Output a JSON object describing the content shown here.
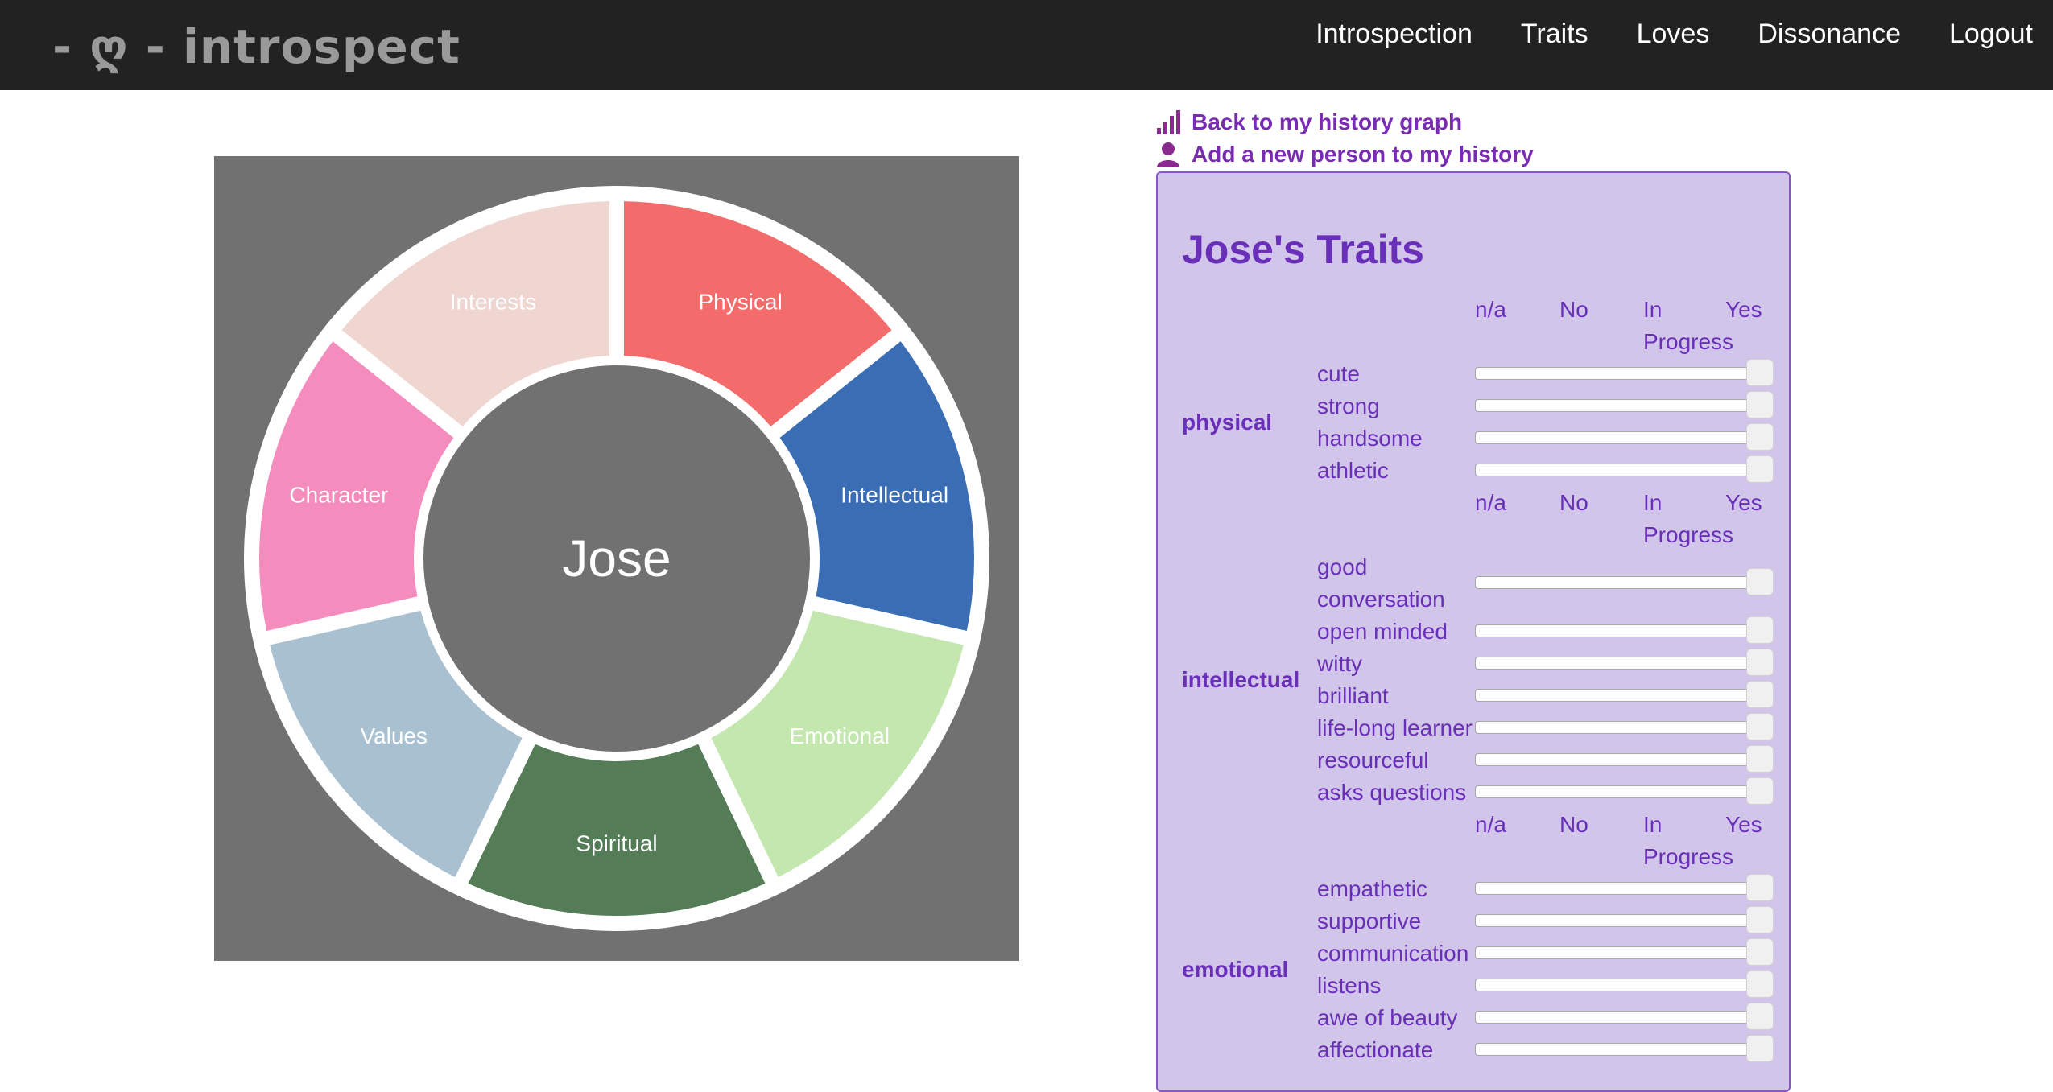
{
  "app": {
    "logo_text": "- ღ - introspect"
  },
  "nav": [
    "Introspection",
    "Traits",
    "Loves",
    "Dissonance",
    "Logout"
  ],
  "links": {
    "history_graph": "Back to my history graph",
    "add_person": "Add a new person to my history"
  },
  "wheel": {
    "center": "Jose",
    "segments": [
      {
        "label": "Physical",
        "color": "#f46b6b"
      },
      {
        "label": "Intellectual",
        "color": "#3b6db5"
      },
      {
        "label": "Emotional",
        "color": "#c4e7b0"
      },
      {
        "label": "Spiritual",
        "color": "#537c57"
      },
      {
        "label": "Values",
        "color": "#a9c0d1"
      },
      {
        "label": "Character",
        "color": "#f48dbd"
      },
      {
        "label": "Interests",
        "color": "#f0d6d0"
      }
    ]
  },
  "traits": {
    "title": "Jose's Traits",
    "headers": [
      "n/a",
      "No",
      "In Progress",
      "Yes"
    ],
    "groups": [
      {
        "category": "physical",
        "items": [
          {
            "name": "cute",
            "value": 1.0
          },
          {
            "name": "strong",
            "value": 1.0
          },
          {
            "name": "handsome",
            "value": 1.0
          },
          {
            "name": "athletic",
            "value": 1.0
          }
        ]
      },
      {
        "category": "intellectual",
        "items": [
          {
            "name": "good conversation",
            "value": 1.0
          },
          {
            "name": "open minded",
            "value": 1.0
          },
          {
            "name": "witty",
            "value": 1.0
          },
          {
            "name": "brilliant",
            "value": 1.0
          },
          {
            "name": "life-long learner",
            "value": 1.0
          },
          {
            "name": "resourceful",
            "value": 1.0
          },
          {
            "name": "asks questions",
            "value": 1.0
          }
        ]
      },
      {
        "category": "emotional",
        "items": [
          {
            "name": "empathetic",
            "value": 1.0
          },
          {
            "name": "supportive",
            "value": 1.0
          },
          {
            "name": "communication",
            "value": 1.0
          },
          {
            "name": "listens",
            "value": 1.0
          },
          {
            "name": "awe of beauty",
            "value": 1.0
          },
          {
            "name": "affectionate",
            "value": 1.0
          }
        ]
      }
    ]
  }
}
